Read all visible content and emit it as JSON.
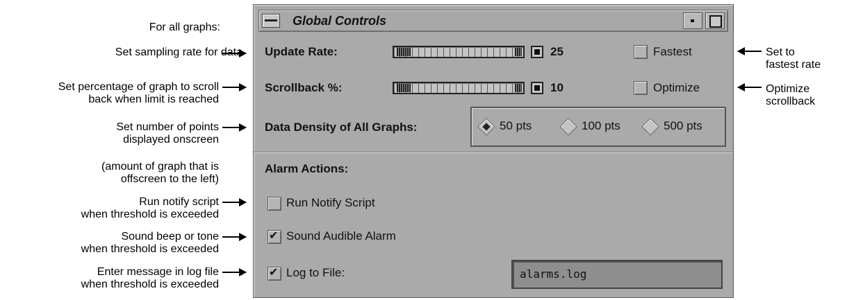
{
  "callouts": {
    "left": [
      {
        "lines": [
          "For all graphs:"
        ]
      },
      {
        "lines": [
          "Set sampling rate for data"
        ]
      },
      {
        "lines": [
          "Set percentage of graph to scroll",
          "back when limit is reached"
        ]
      },
      {
        "lines": [
          "Set number of points",
          "displayed onscreen"
        ]
      },
      {
        "lines": [
          "(amount of graph that is",
          "offscreen to the left)"
        ]
      },
      {
        "lines": [
          "Run notify script",
          "when threshold is exceeded"
        ]
      },
      {
        "lines": [
          "Sound beep or tone",
          "when threshold is exceeded"
        ]
      },
      {
        "lines": [
          "Enter message in log file",
          "when threshold is exceeded"
        ]
      }
    ],
    "right": [
      {
        "lines": [
          "Set to",
          "fastest rate"
        ]
      },
      {
        "lines": [
          "Optimize",
          "scrollback"
        ]
      }
    ]
  },
  "window": {
    "title": "Global Controls",
    "icons": {
      "menu": "window-menu-icon",
      "minimize": "minimize-icon",
      "maximize": "maximize-icon"
    }
  },
  "controls": {
    "update_rate": {
      "label": "Update Rate:",
      "value": "25",
      "toggle_label": "Fastest",
      "toggle_checked": false
    },
    "scrollback": {
      "label": "Scrollback %:",
      "value": "10",
      "toggle_label": "Optimize",
      "toggle_checked": false
    },
    "density": {
      "label": "Data Density of All Graphs:",
      "options": [
        "50 pts",
        "100 pts",
        "500 pts"
      ],
      "selected": "50 pts"
    }
  },
  "alarm": {
    "header": "Alarm Actions:",
    "run_notify": {
      "label": "Run Notify Script",
      "checked": false
    },
    "sound_alarm": {
      "label": "Sound Audible Alarm",
      "checked": true
    },
    "log_to_file": {
      "label": "Log to File:",
      "checked": true,
      "filename": "alarms.log"
    }
  }
}
